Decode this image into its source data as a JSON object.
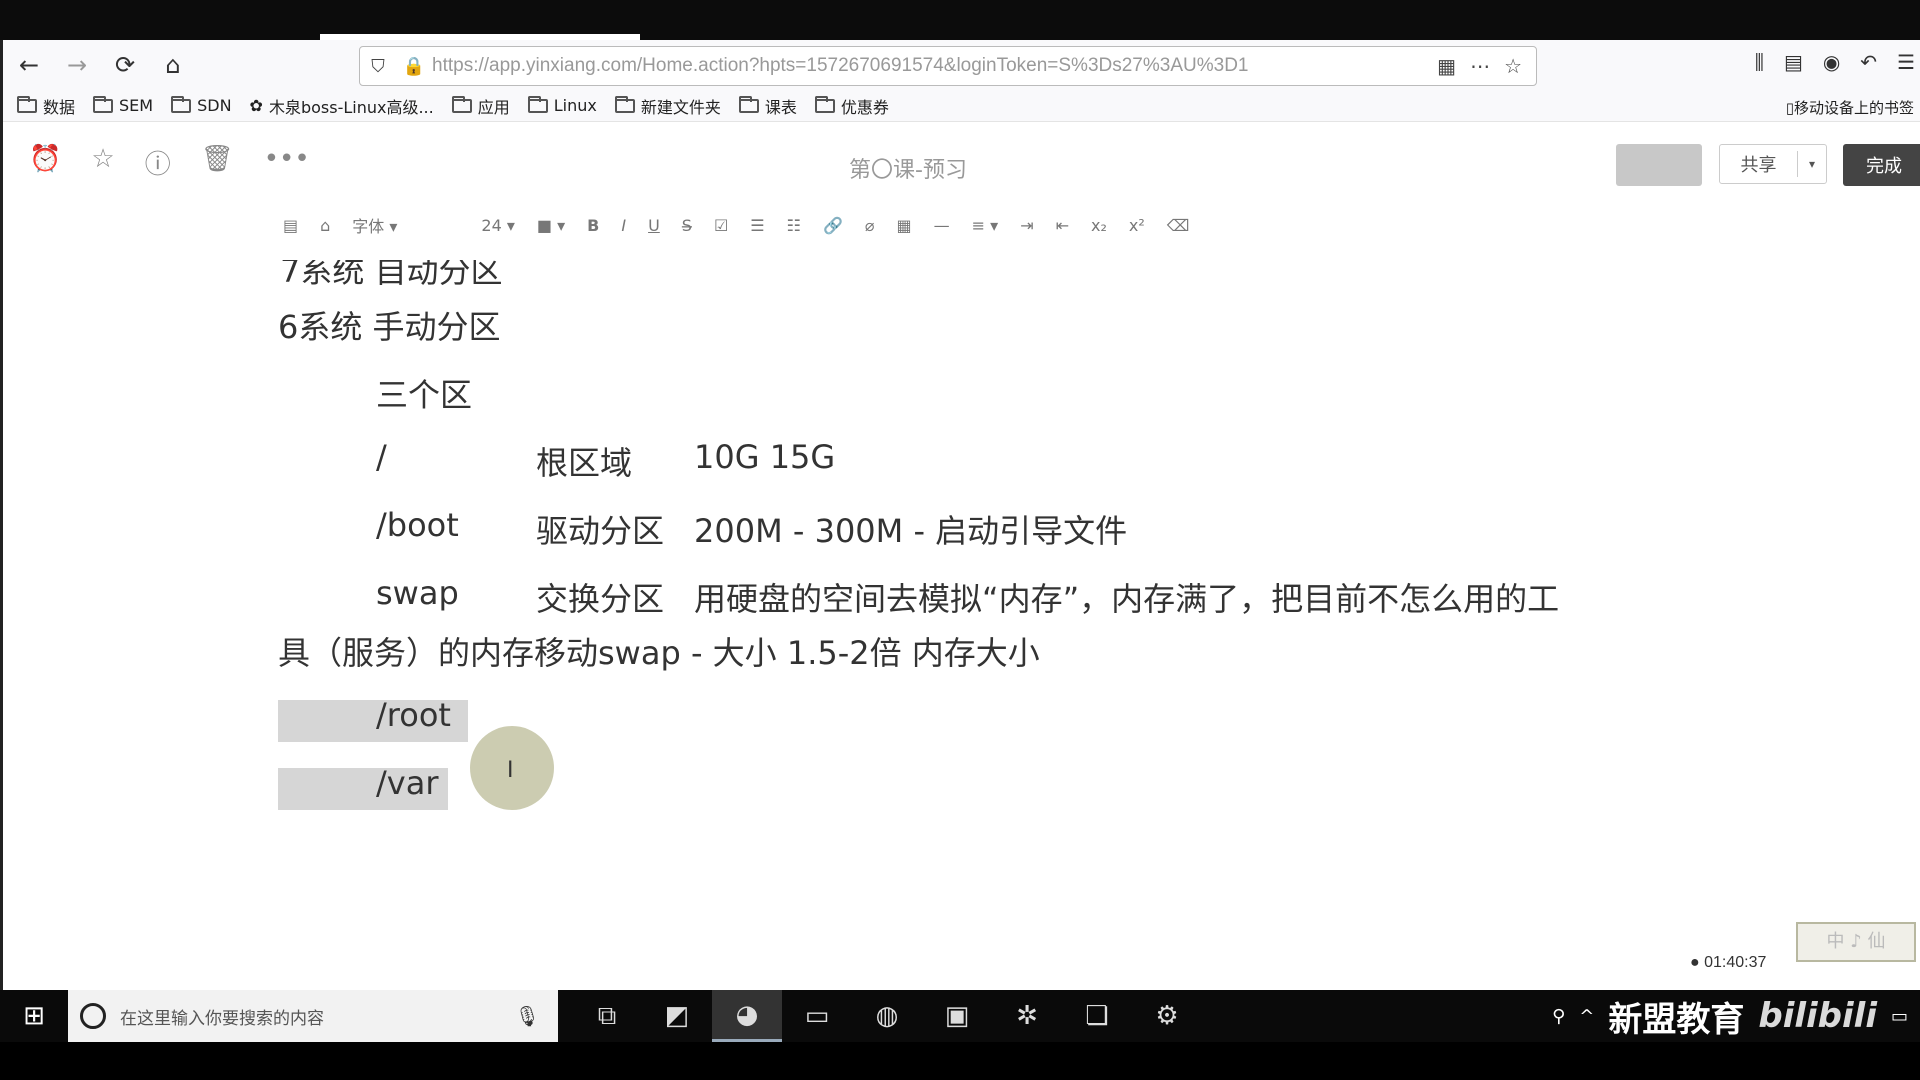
{
  "browser": {
    "url": "https://app.yinxiang.com/Home.action?hpts=1572670691574&loginToken=S%3Ds27%3AU%3D1",
    "bookmarks": [
      "数据",
      "SEM",
      "SDN",
      "木泉boss-Linux高级...",
      "应用",
      "Linux",
      "新建文件夹",
      "课表",
      "优惠券"
    ],
    "mobile_bookmarks": "移动设备上的书签"
  },
  "app": {
    "doc_title": "第〇课-预习",
    "share_label": "共享",
    "done_label": "完成"
  },
  "format_toolbar": {
    "font_label": "字体",
    "size_label": "24"
  },
  "document": {
    "lines": [
      "7系统 自动分区",
      "6系统 手动分区",
      "三个区",
      "/",
      "根区域",
      "10G  15G",
      "/boot",
      "驱动分区",
      "200M - 300M - 启动引导文件",
      "swap",
      "交换分区",
      "用硬盘的空间去模拟“内存”，内存满了，把目前不怎么用的工",
      "具（服务）的内存移动swap - 大小 1.5-2倍 内存大小",
      "/root",
      "/var"
    ]
  },
  "overlay": {
    "timer": "01:40:37",
    "watermark": "中 ♪ 仙"
  },
  "taskbar": {
    "search_placeholder": "在这里输入你要搜索的内容",
    "brand": "新盟教育",
    "bili": "bilibili"
  }
}
